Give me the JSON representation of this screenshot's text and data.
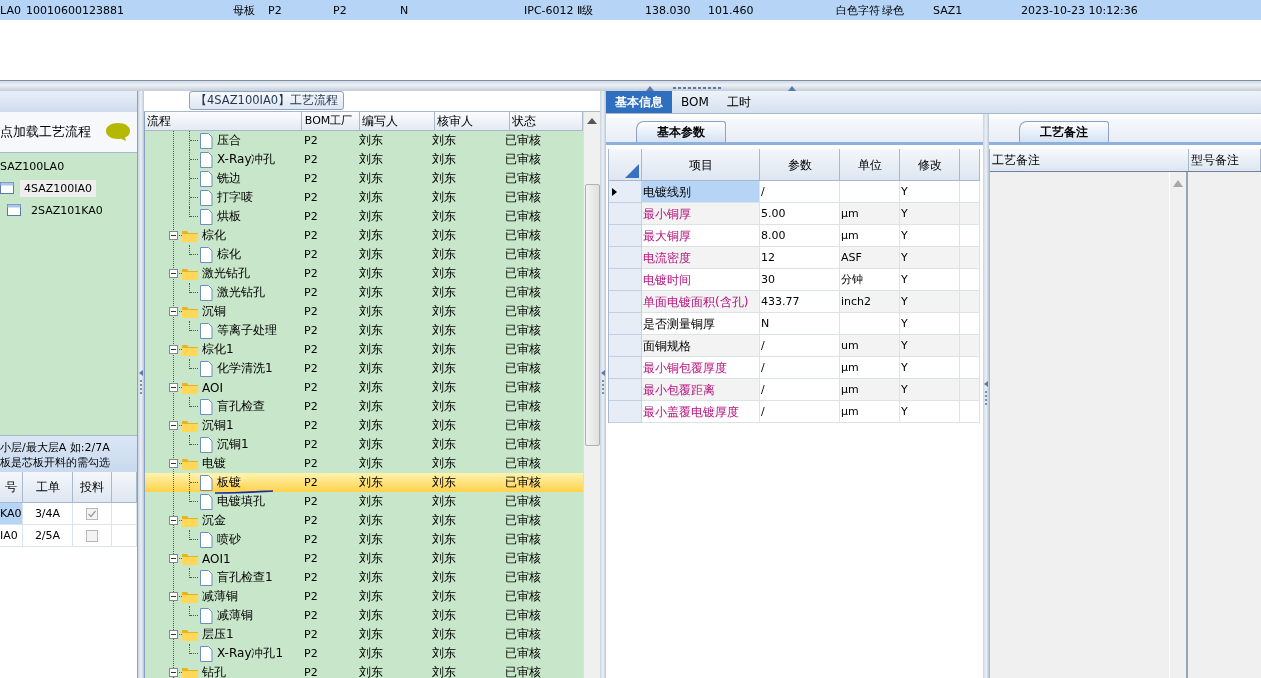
{
  "top_row": {
    "selected": true,
    "cells": [
      "LA0",
      "10010600123881",
      "母板",
      "P2",
      "P2",
      "N",
      "IPC-6012 Ⅱ级",
      "138.030",
      "101.460",
      "白色字符",
      "绿色",
      "SAZ1",
      "2023-10-23 10:12:36"
    ]
  },
  "left_panel": {
    "load_hint": "点加载工艺流程",
    "tree": {
      "label": "SAZ100LA0",
      "children": [
        {
          "label": "4SAZ100IA0",
          "selected": true
        },
        {
          "label": "2SAZ101KA0",
          "selected": false
        }
      ]
    },
    "note_lines": [
      "小层/最大层A 如:2/7A",
      "板是芯板开料的需勾选"
    ],
    "table": {
      "columns": [
        "号",
        "工单",
        "投料"
      ],
      "rows": [
        {
          "cells": [
            "KA0",
            "3/4A"
          ],
          "checked": true,
          "selected": true
        },
        {
          "cells": [
            "IA0",
            "2/5A"
          ],
          "checked": false,
          "selected": false
        }
      ]
    }
  },
  "flow_panel": {
    "title": "【4SAZ100IA0】工艺流程",
    "columns": [
      "流程",
      "BOM工厂",
      "编写人",
      "核审人",
      "状态"
    ],
    "rows": [
      {
        "kind": "continued",
        "children": [
          {
            "name": "压合",
            "factory": "P2",
            "writer": "刘东",
            "reviewer": "刘东",
            "status": "已审核",
            "selected": false
          },
          {
            "name": "X-Ray冲孔",
            "factory": "P2",
            "writer": "刘东",
            "reviewer": "刘东",
            "status": "已审核",
            "selected": false
          },
          {
            "name": "铣边",
            "factory": "P2",
            "writer": "刘东",
            "reviewer": "刘东",
            "status": "已审核",
            "selected": false
          },
          {
            "name": "打字唛",
            "factory": "P2",
            "writer": "刘东",
            "reviewer": "刘东",
            "status": "已审核",
            "selected": false
          },
          {
            "name": "烘板",
            "factory": "P2",
            "writer": "刘东",
            "reviewer": "刘东",
            "status": "已审核",
            "selected": false
          }
        ]
      },
      {
        "kind": "folder",
        "name": "棕化",
        "factory": "P2",
        "writer": "刘东",
        "reviewer": "刘东",
        "status": "已审核",
        "selected": false,
        "expanded": true,
        "children": [
          {
            "name": "棕化",
            "factory": "P2",
            "writer": "刘东",
            "reviewer": "刘东",
            "status": "已审核",
            "selected": false
          }
        ]
      },
      {
        "kind": "folder",
        "name": "激光钻孔",
        "factory": "P2",
        "writer": "刘东",
        "reviewer": "刘东",
        "status": "已审核",
        "selected": false,
        "expanded": true,
        "children": [
          {
            "name": "激光钻孔",
            "factory": "P2",
            "writer": "刘东",
            "reviewer": "刘东",
            "status": "已审核",
            "selected": false
          }
        ]
      },
      {
        "kind": "folder",
        "name": "沉铜",
        "factory": "P2",
        "writer": "刘东",
        "reviewer": "刘东",
        "status": "已审核",
        "selected": false,
        "expanded": true,
        "children": [
          {
            "name": "等离子处理",
            "factory": "P2",
            "writer": "刘东",
            "reviewer": "刘东",
            "status": "已审核",
            "selected": false
          }
        ]
      },
      {
        "kind": "folder",
        "name": "棕化1",
        "factory": "P2",
        "writer": "刘东",
        "reviewer": "刘东",
        "status": "已审核",
        "selected": false,
        "expanded": true,
        "children": [
          {
            "name": "化学清洗1",
            "factory": "P2",
            "writer": "刘东",
            "reviewer": "刘东",
            "status": "已审核",
            "selected": false
          }
        ]
      },
      {
        "kind": "folder",
        "name": "AOI",
        "factory": "P2",
        "writer": "刘东",
        "reviewer": "刘东",
        "status": "已审核",
        "selected": false,
        "expanded": true,
        "children": [
          {
            "name": "盲孔检查",
            "factory": "P2",
            "writer": "刘东",
            "reviewer": "刘东",
            "status": "已审核",
            "selected": false
          }
        ]
      },
      {
        "kind": "folder",
        "name": "沉铜1",
        "factory": "P2",
        "writer": "刘东",
        "reviewer": "刘东",
        "status": "已审核",
        "selected": false,
        "expanded": true,
        "children": [
          {
            "name": "沉铜1",
            "factory": "P2",
            "writer": "刘东",
            "reviewer": "刘东",
            "status": "已审核",
            "selected": false
          }
        ]
      },
      {
        "kind": "folder",
        "name": "电镀",
        "factory": "P2",
        "writer": "刘东",
        "reviewer": "刘东",
        "status": "已审核",
        "selected": false,
        "expanded": true,
        "children": [
          {
            "name": "板镀",
            "factory": "P2",
            "writer": "刘东",
            "reviewer": "刘东",
            "status": "已审核",
            "selected": true
          },
          {
            "name": "电镀填孔",
            "factory": "P2",
            "writer": "刘东",
            "reviewer": "刘东",
            "status": "已审核",
            "selected": false
          }
        ]
      },
      {
        "kind": "folder",
        "name": "沉金",
        "factory": "P2",
        "writer": "刘东",
        "reviewer": "刘东",
        "status": "已审核",
        "selected": false,
        "expanded": true,
        "children": [
          {
            "name": "喷砂",
            "factory": "P2",
            "writer": "刘东",
            "reviewer": "刘东",
            "status": "已审核",
            "selected": false
          }
        ]
      },
      {
        "kind": "folder",
        "name": "AOI1",
        "factory": "P2",
        "writer": "刘东",
        "reviewer": "刘东",
        "status": "已审核",
        "selected": false,
        "expanded": true,
        "children": [
          {
            "name": "盲孔检查1",
            "factory": "P2",
            "writer": "刘东",
            "reviewer": "刘东",
            "status": "已审核",
            "selected": false
          }
        ]
      },
      {
        "kind": "folder",
        "name": "减薄铜",
        "factory": "P2",
        "writer": "刘东",
        "reviewer": "刘东",
        "status": "已审核",
        "selected": false,
        "expanded": true,
        "children": [
          {
            "name": "减薄铜",
            "factory": "P2",
            "writer": "刘东",
            "reviewer": "刘东",
            "status": "已审核",
            "selected": false
          }
        ]
      },
      {
        "kind": "folder",
        "name": "层压1",
        "factory": "P2",
        "writer": "刘东",
        "reviewer": "刘东",
        "status": "已审核",
        "selected": false,
        "expanded": true,
        "children": [
          {
            "name": "X-Ray冲孔1",
            "factory": "P2",
            "writer": "刘东",
            "reviewer": "刘东",
            "status": "已审核",
            "selected": false
          }
        ]
      },
      {
        "kind": "folder",
        "name": "钻孔",
        "factory": "P2",
        "writer": "刘东",
        "reviewer": "刘东",
        "status": "已审核",
        "selected": false,
        "expanded": true
      }
    ]
  },
  "detail": {
    "tabs": [
      {
        "label": "基本信息",
        "selected": true
      },
      {
        "label": "BOM",
        "selected": false
      },
      {
        "label": "工时",
        "selected": false
      }
    ],
    "subtab": "基本参数",
    "columns": [
      "项目",
      "参数",
      "单位",
      "修改"
    ],
    "rows": [
      {
        "item": "电镀线别",
        "value": "/",
        "unit": "",
        "modify": "Y",
        "required": false,
        "selected": true
      },
      {
        "item": "最小铜厚",
        "value": "5.00",
        "unit": "μm",
        "modify": "Y",
        "required": true,
        "selected": false
      },
      {
        "item": "最大铜厚",
        "value": "8.00",
        "unit": "μm",
        "modify": "Y",
        "required": true,
        "selected": false
      },
      {
        "item": "电流密度",
        "value": "12",
        "unit": "ASF",
        "modify": "Y",
        "required": true,
        "selected": false
      },
      {
        "item": "电镀时间",
        "value": "30",
        "unit": "分钟",
        "modify": "Y",
        "required": true,
        "selected": false
      },
      {
        "item": "单面电镀面积(含孔)",
        "value": "433.77",
        "unit": "inch2",
        "modify": "Y",
        "required": true,
        "selected": false
      },
      {
        "item": "是否测量铜厚",
        "value": "N",
        "unit": "",
        "modify": "Y",
        "required": false,
        "selected": false
      },
      {
        "item": "面铜规格",
        "value": "/",
        "unit": "um",
        "modify": "Y",
        "required": false,
        "selected": false
      },
      {
        "item": "最小铜包覆厚度",
        "value": "/",
        "unit": "μm",
        "modify": "Y",
        "required": true,
        "selected": false
      },
      {
        "item": "最小包覆距离",
        "value": "/",
        "unit": "μm",
        "modify": "Y",
        "required": true,
        "selected": false
      },
      {
        "item": "最小盖覆电镀厚度",
        "value": "/",
        "unit": "μm",
        "modify": "Y",
        "required": true,
        "selected": false
      }
    ]
  },
  "notes": {
    "tab": "工艺备注",
    "columns": [
      "工艺备注",
      "型号备注"
    ]
  }
}
